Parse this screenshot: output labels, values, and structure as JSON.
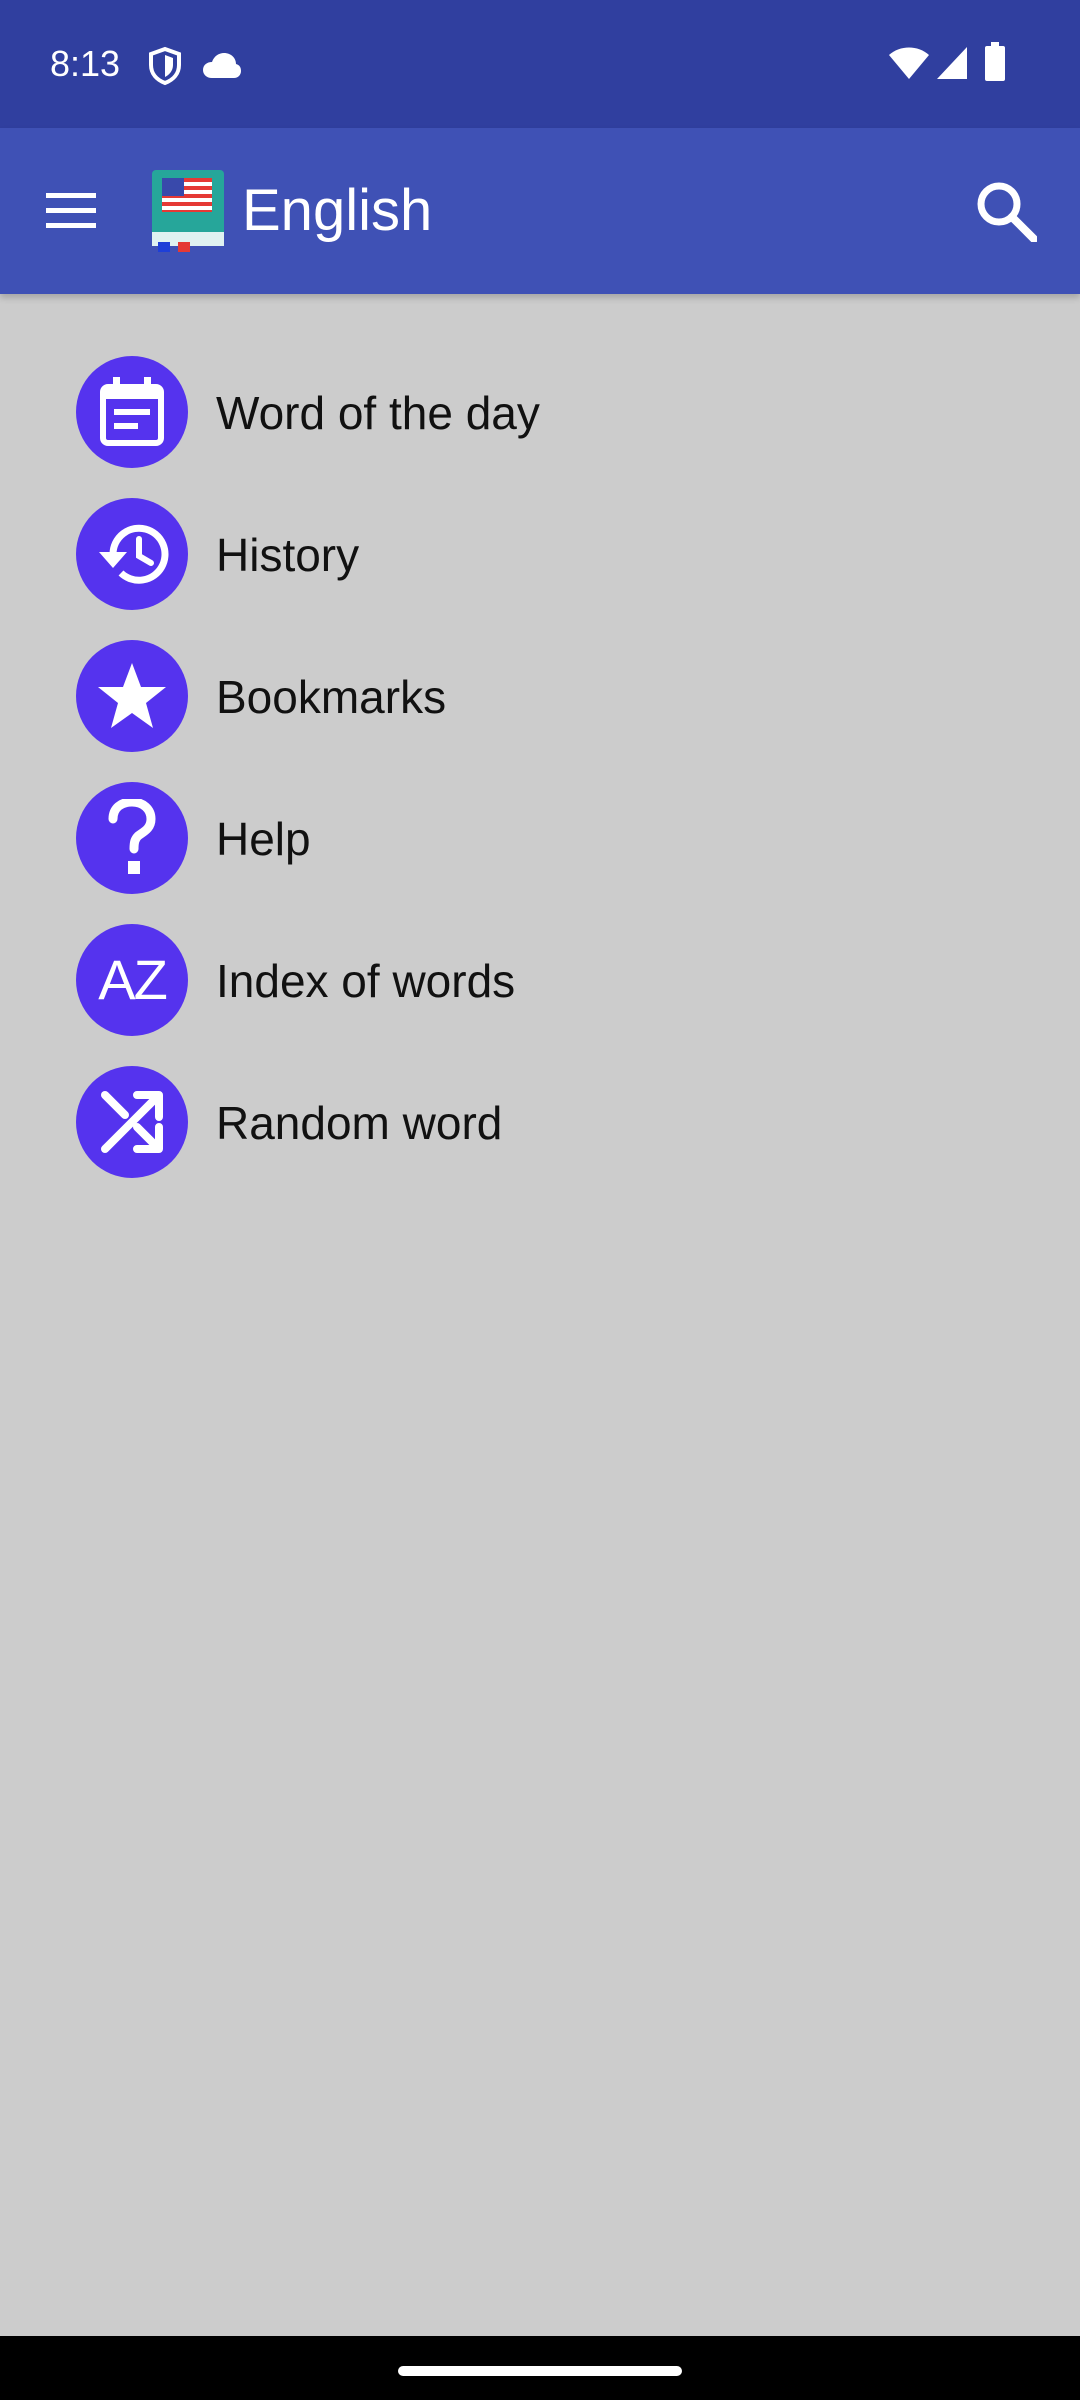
{
  "status_bar": {
    "time": "8:13",
    "icons": [
      "shield-icon",
      "cloud-icon",
      "wifi-icon",
      "signal-icon",
      "battery-icon"
    ]
  },
  "app_bar": {
    "title": "English",
    "menu_icon": "hamburger-menu-icon",
    "logo_icon": "dictionary-book-flag-icon",
    "search_icon": "search-icon"
  },
  "menu": {
    "items": [
      {
        "label": "Word of the day",
        "icon": "calendar-icon"
      },
      {
        "label": "History",
        "icon": "history-icon"
      },
      {
        "label": "Bookmarks",
        "icon": "star-icon"
      },
      {
        "label": "Help",
        "icon": "help-icon"
      },
      {
        "label": "Index of words",
        "icon": "az-index-icon",
        "icon_text": "AZ"
      },
      {
        "label": "Random word",
        "icon": "shuffle-icon"
      }
    ]
  },
  "colors": {
    "status_bar": "#303f9f",
    "app_bar": "#3f51b5",
    "background": "#cccccc",
    "icon_circle": "#5533ee",
    "nav_bar": "#000000"
  }
}
